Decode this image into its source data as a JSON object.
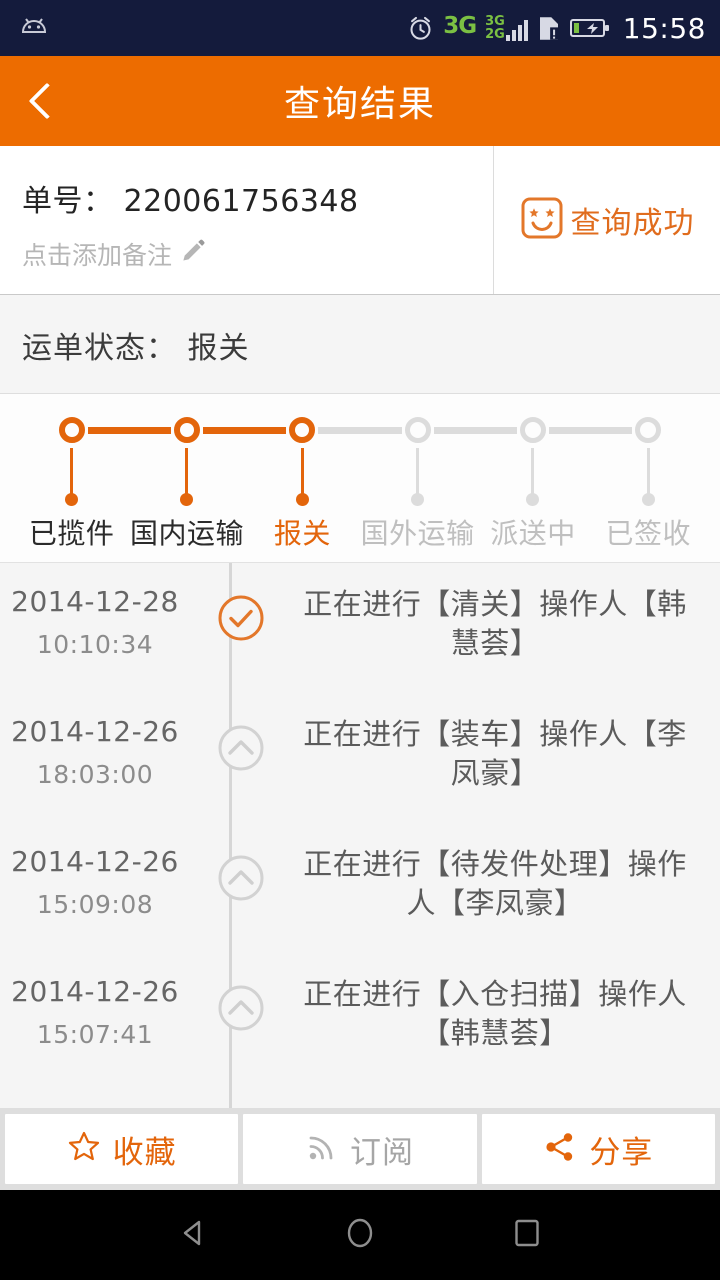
{
  "statusbar": {
    "android_icon": "android-robot-icon",
    "alarm_icon": "alarm-clock-icon",
    "network_label": "3G",
    "network_sub_top": "3G",
    "network_sub_bottom": "2G",
    "sim_icon": "sim-card-alert-icon",
    "battery_icon": "battery-charging-icon",
    "time": "15:58"
  },
  "appbar": {
    "back_icon": "chevron-left-icon",
    "title": "查询结果"
  },
  "order": {
    "number_label": "单号：",
    "number": "220061756348",
    "number_full": "单号： 220061756348",
    "note_placeholder": "点击添加备注",
    "note_icon": "pencil-icon",
    "success_icon": "smiley-face-icon",
    "success_text": "查询成功"
  },
  "status": {
    "label": "运单状态：",
    "value": "报关",
    "full": "运单状态： 报关"
  },
  "stepper": {
    "current_index": 2,
    "steps": [
      {
        "label": "已揽件",
        "state": "done"
      },
      {
        "label": "国内运输",
        "state": "done"
      },
      {
        "label": "报关",
        "state": "active"
      },
      {
        "label": "国外运输",
        "state": "todo"
      },
      {
        "label": "派送中",
        "state": "todo"
      },
      {
        "label": "已签收",
        "state": "todo"
      }
    ]
  },
  "timeline": {
    "entries": [
      {
        "date": "2014-12-28",
        "time": "10:10:34",
        "text": "正在进行【清关】操作人【韩慧荟】",
        "marker_icon": "check-circle-icon",
        "marker_state": "current"
      },
      {
        "date": "2014-12-26",
        "time": "18:03:00",
        "text": "正在进行【装车】操作人【李凤豪】",
        "marker_icon": "chevron-up-circle-icon",
        "marker_state": "past"
      },
      {
        "date": "2014-12-26",
        "time": "15:09:08",
        "text": "正在进行【待发件处理】操作人【李凤豪】",
        "marker_icon": "chevron-up-circle-icon",
        "marker_state": "past"
      },
      {
        "date": "2014-12-26",
        "time": "15:07:41",
        "text": "正在进行【入仓扫描】操作人【韩慧荟】",
        "marker_icon": "chevron-up-circle-icon",
        "marker_state": "past"
      }
    ]
  },
  "actions": [
    {
      "label": "收藏",
      "icon": "star-outline-icon",
      "style": "accent"
    },
    {
      "label": "订阅",
      "icon": "rss-feed-icon",
      "style": "muted"
    },
    {
      "label": "分享",
      "icon": "share-nodes-icon",
      "style": "accent"
    }
  ],
  "navbar": {
    "back": "nav-back-triangle-icon",
    "home": "nav-home-circle-icon",
    "recents": "nav-recents-square-icon"
  },
  "colors": {
    "brand_orange": "#ed6c00",
    "step_orange": "#e3650b",
    "status_bar": "#141b3c",
    "page_bg": "#f5f5f5",
    "muted_gray": "#dcdcdc"
  }
}
